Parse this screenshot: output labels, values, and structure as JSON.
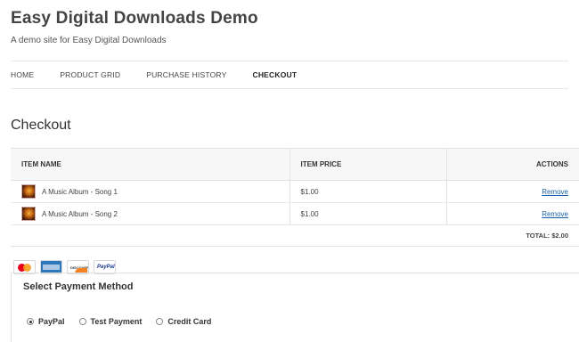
{
  "site": {
    "title": "Easy Digital Downloads Demo",
    "description": "A demo site for Easy Digital Downloads"
  },
  "nav": {
    "items": [
      {
        "label": "HOME",
        "active": false
      },
      {
        "label": "PRODUCT GRID",
        "active": false
      },
      {
        "label": "PURCHASE HISTORY",
        "active": false
      },
      {
        "label": "CHECKOUT",
        "active": true
      }
    ]
  },
  "page": {
    "title": "Checkout"
  },
  "cart": {
    "headers": {
      "item_name": "ITEM NAME",
      "item_price": "ITEM PRICE",
      "actions": "ACTIONS"
    },
    "items": [
      {
        "name": "A Music Album - Song 1",
        "price": "$1.00",
        "action": "Remove"
      },
      {
        "name": "A Music Album - Song 2",
        "price": "$1.00",
        "action": "Remove"
      }
    ],
    "total": "TOTAL: $2.00"
  },
  "payment_icons": [
    {
      "icon": "mastercard-icon"
    },
    {
      "icon": "amex-icon"
    },
    {
      "icon": "discover-icon",
      "text": "DISCOVER"
    },
    {
      "icon": "paypal-icon",
      "text": "PayPal"
    }
  ],
  "payment": {
    "legend": "Select Payment Method",
    "options": [
      {
        "label": "PayPal",
        "selected": true
      },
      {
        "label": "Test Payment",
        "selected": false
      },
      {
        "label": "Credit Card",
        "selected": false
      }
    ]
  }
}
